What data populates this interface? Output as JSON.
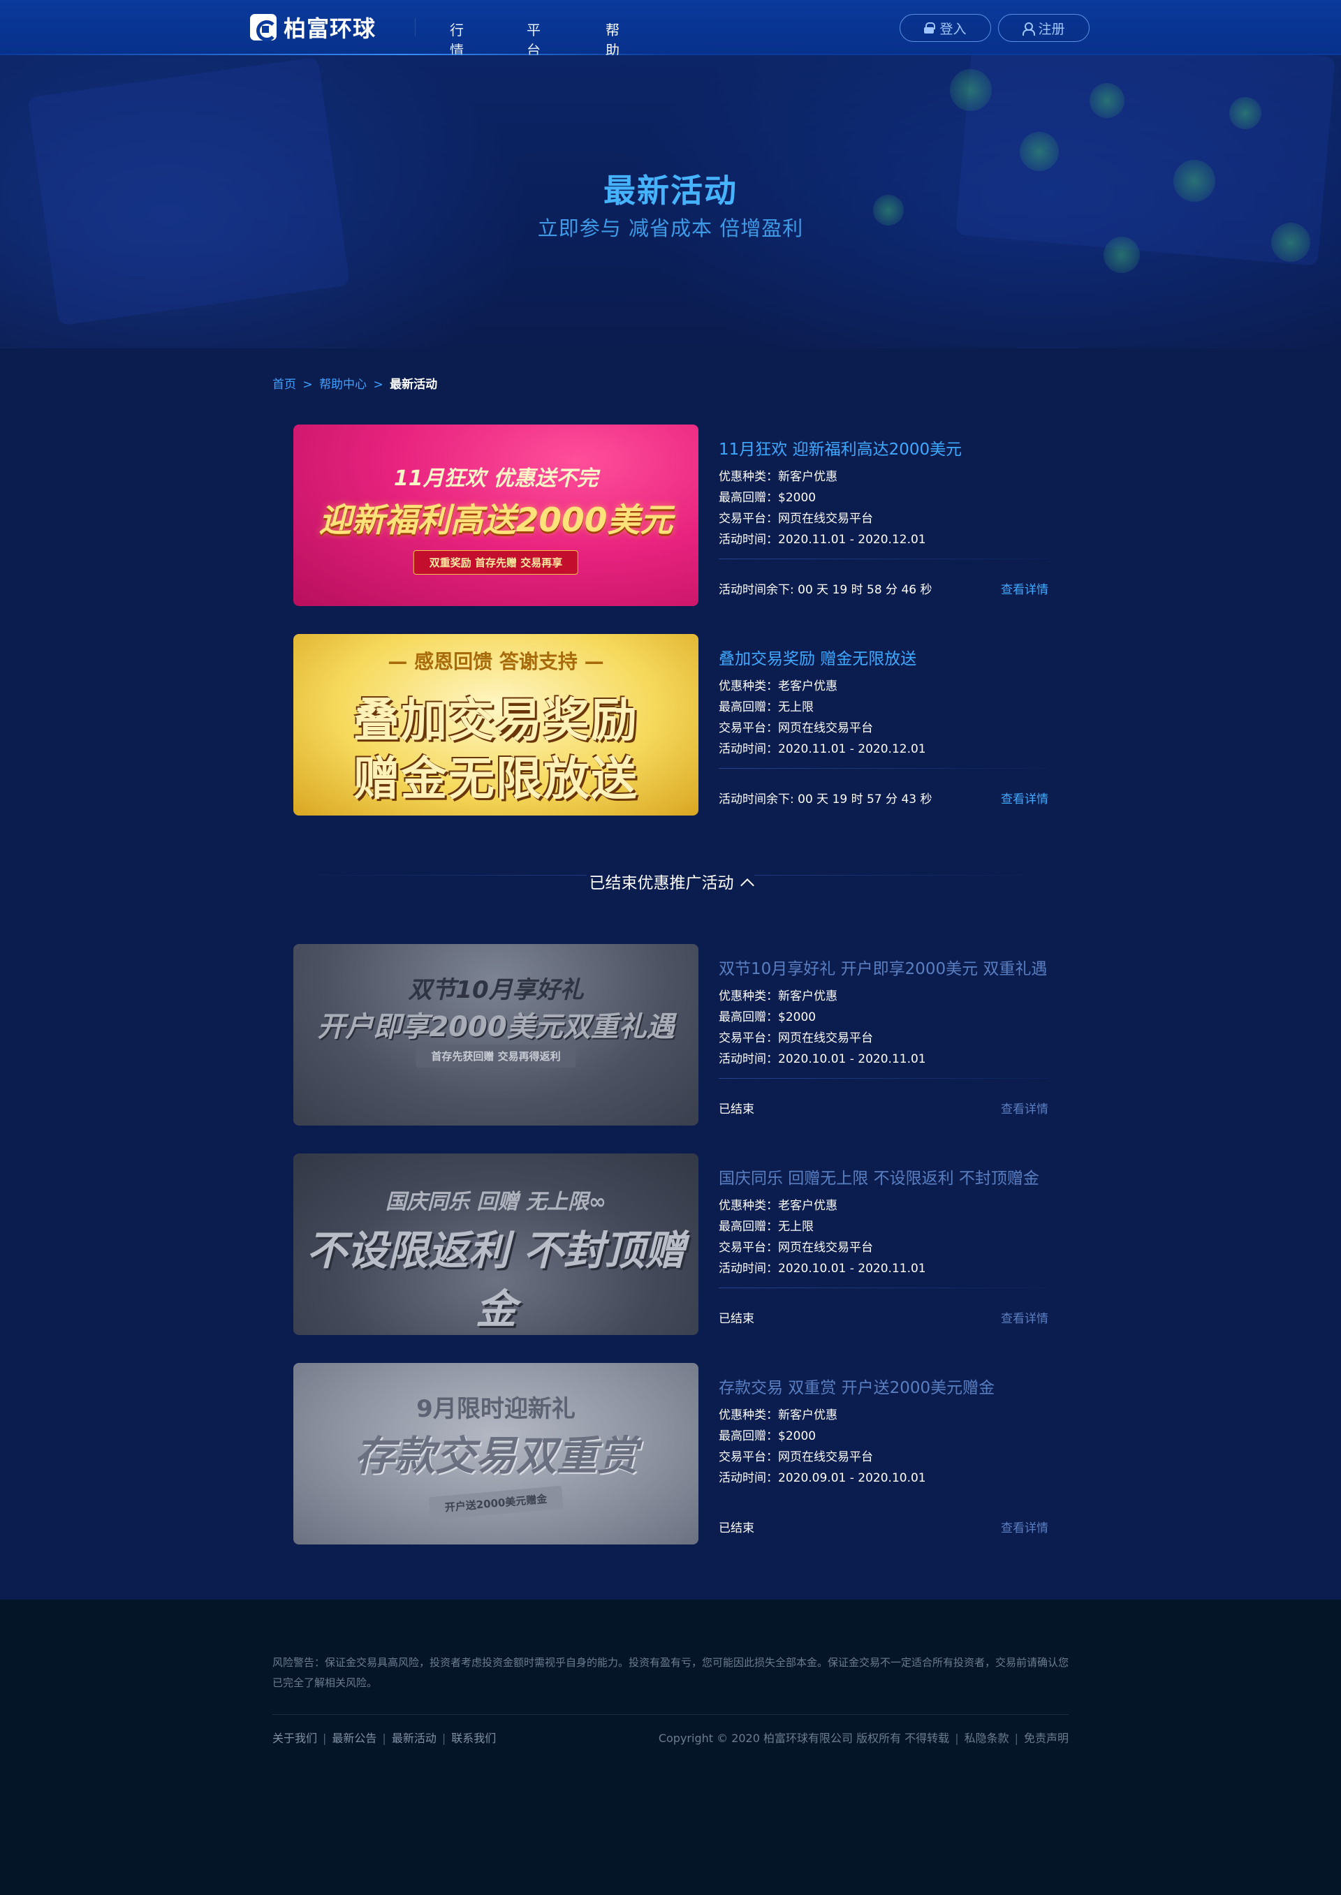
{
  "header": {
    "logo_text": "柏富环球",
    "nav": [
      "行情",
      "平台",
      "帮助中心"
    ],
    "active_nav": "帮助中心",
    "login_label": "登入",
    "register_label": "注册"
  },
  "hero": {
    "title": "最新活动",
    "subtitle": "立即参与 减省成本 倍增盈利"
  },
  "breadcrumb": {
    "home": "首页",
    "help": "帮助中心",
    "current": "最新活动",
    "separator": ">"
  },
  "detail_labels": {
    "type": "优惠种类：",
    "max": "最高回赠：",
    "platform": "交易平台：",
    "time": "活动时间："
  },
  "active_activities": [
    {
      "title": "11月狂欢 迎新福利高达2000美元",
      "type": "新客户优惠",
      "max": "$2000",
      "platform": "网页在线交易平台",
      "time": "2020.11.01 - 2020.12.01",
      "status": "活动时间余下: 00 天 19 时 58 分 46 秒",
      "link": "查看详情",
      "banner": {
        "top": "11月狂欢  优惠送不完",
        "main": "迎新福利高送2000美元",
        "pill": "双重奖励  首存先赠  交易再享"
      }
    },
    {
      "title": "叠加交易奖励 赠金无限放送",
      "type": "老客户优惠",
      "max": "无上限",
      "platform": "网页在线交易平台",
      "time": "2020.11.01 - 2020.12.01",
      "status": "活动时间余下: 00 天 19 时 57 分 43 秒",
      "link": "查看详情",
      "banner": {
        "top": "— 感恩回馈  答谢支持 —",
        "main1": "叠加交易奖励",
        "main2": "赠金无限放送"
      }
    }
  ],
  "ended_heading": "已结束优惠推广活动",
  "ended_activities": [
    {
      "title": "双节10月享好礼 开户即享2000美元 双重礼遇",
      "type": "新客户优惠",
      "max": "$2000",
      "platform": "网页在线交易平台",
      "time": "2020.10.01 - 2020.11.01",
      "status": "已结束",
      "link": "查看详情",
      "banner": {
        "top": "双节10月享好礼",
        "main": "开户即享2000美元双重礼遇",
        "pill": "首存先获回赠  交易再得返利"
      }
    },
    {
      "title": "国庆同乐 回赠无上限 不设限返利 不封顶赠金",
      "type": "老客户优惠",
      "max": "无上限",
      "platform": "网页在线交易平台",
      "time": "2020.10.01 - 2020.11.01",
      "status": "已结束",
      "link": "查看详情",
      "banner": {
        "top": "国庆同乐 回赠 无上限∞",
        "main": "不设限返利 不封顶赠金"
      }
    },
    {
      "title": "存款交易 双重赏 开户送2000美元赠金",
      "type": "新客户优惠",
      "max": "$2000",
      "platform": "网页在线交易平台",
      "time": "2020.09.01 - 2020.10.01",
      "status": "已结束",
      "link": "查看详情",
      "banner": {
        "top": "9月限时迎新礼",
        "main": "存款交易双重赏",
        "pill": "开户送2000美元赠金"
      }
    }
  ],
  "footer": {
    "warning": "风险警告：保证金交易具高风险，投资者考虑投资金额时需视乎自身的能力。投资有盈有亏，您可能因此损失全部本金。保证金交易不一定适合所有投资者，交易前请确认您已完全了解相关风险。",
    "links": [
      "关于我们",
      "最新公告",
      "最新活动",
      "联系我们"
    ],
    "copyright": "Copyright © 2020 柏富环球有限公司 版权所有 不得转载",
    "privacy": "私隐条款",
    "disclaimer": "免责声明"
  },
  "colors": {
    "accent": "#3fa9ff",
    "header_bg": "#0a3a9c",
    "page_bg": "#0b1c4f",
    "footer_bg": "#041527",
    "ended_text": "#5a7fc0"
  }
}
